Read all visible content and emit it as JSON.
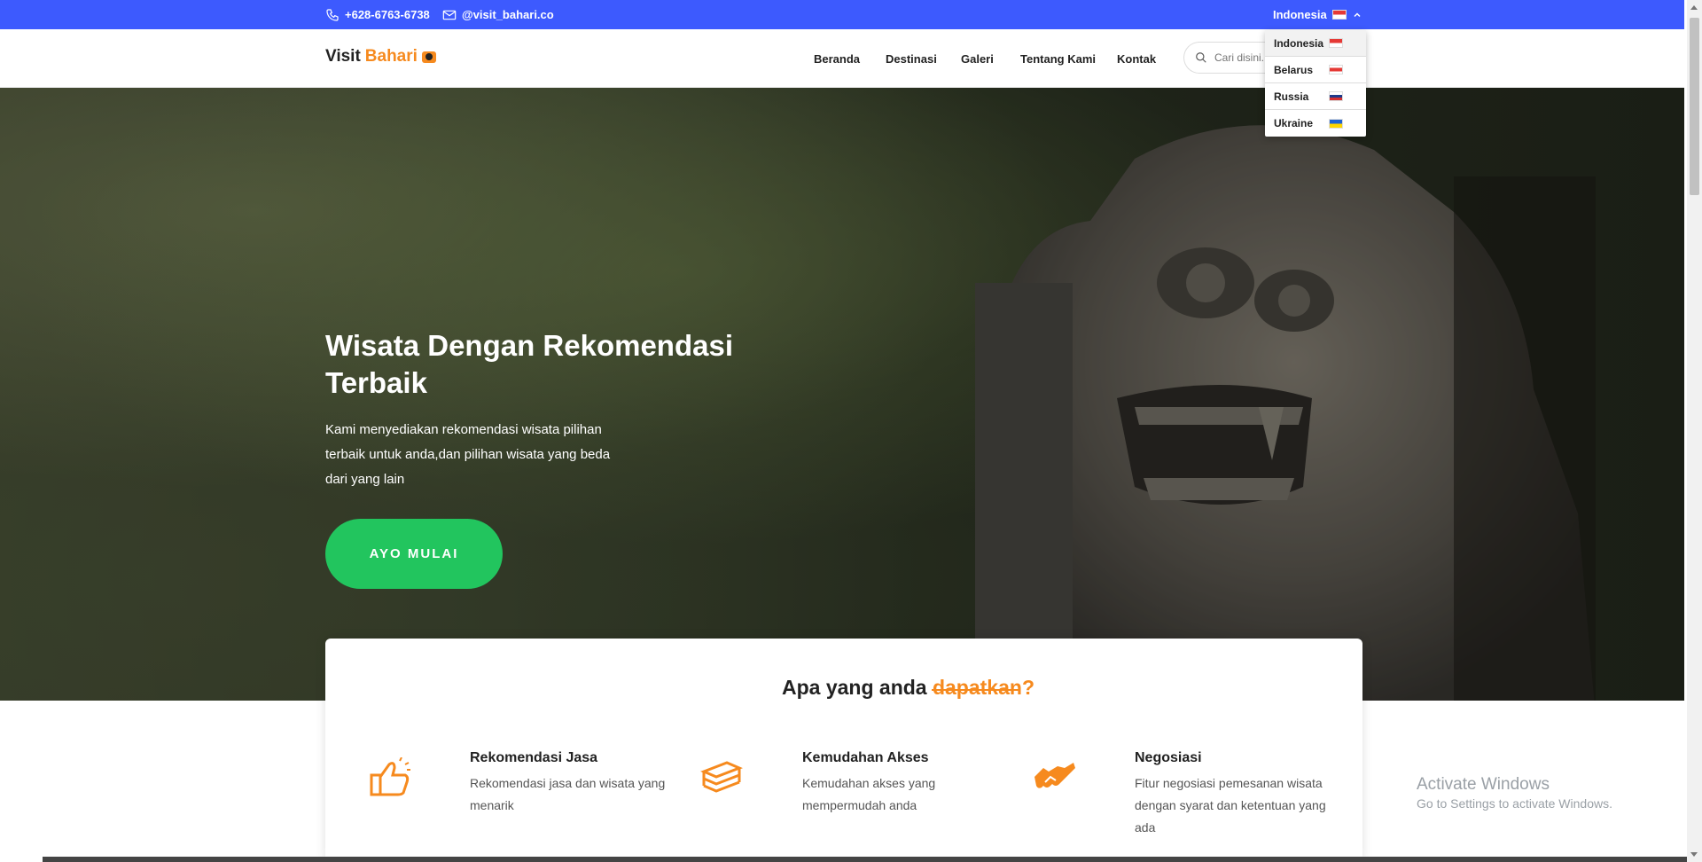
{
  "topbar": {
    "phone": "+628-6763-6738",
    "email": "@visit_bahari.co",
    "language": "Indonesia",
    "colors": {
      "background": "#3d5afe"
    }
  },
  "navbar": {
    "brand_main": "Visit",
    "brand_accent": "Bahari",
    "links": [
      "Beranda",
      "Destinasi",
      "Galeri",
      "Tentang Kami",
      "Kontak"
    ],
    "search_placeholder": "Cari disini..."
  },
  "language_menu": [
    {
      "label": "Indonesia",
      "flag": "flag-indonesia-icon"
    },
    {
      "label": "Belarus",
      "flag": "flag-belarus-icon"
    },
    {
      "label": "Russia",
      "flag": "flag-russia-icon"
    },
    {
      "label": "Ukraine",
      "flag": "flag-ukraine-icon"
    }
  ],
  "hero": {
    "title": "Wisata Dengan Rekomendasi Terbaik",
    "description": "Kami menyediakan rekomendasi wisata pilihan terbaik untuk anda,dan pilihan wisata yang beda dari yang lain",
    "cta": "AYO MULAI",
    "colors": {
      "cta": "#22c55e"
    }
  },
  "features": {
    "title_main": "Apa yang anda ",
    "title_accent": "dapatkan?",
    "accent_color": "#f68a1e",
    "items": [
      {
        "icon": "thumbs-up-icon",
        "title": "Rekomendasi Jasa",
        "desc": "Rekomendasi jasa dan wisata yang menarik"
      },
      {
        "icon": "stack-layers-icon",
        "title": "Kemudahan Akses",
        "desc": "Kemudahan akses yang mempermudah anda"
      },
      {
        "icon": "handshake-icon",
        "title": "Negosiasi",
        "desc": "Fitur negosiasi pemesanan wisata dengan syarat dan ketentuan yang ada"
      }
    ]
  },
  "watermark": {
    "line1": "Activate Windows",
    "line2": "Go to Settings to activate Windows."
  }
}
